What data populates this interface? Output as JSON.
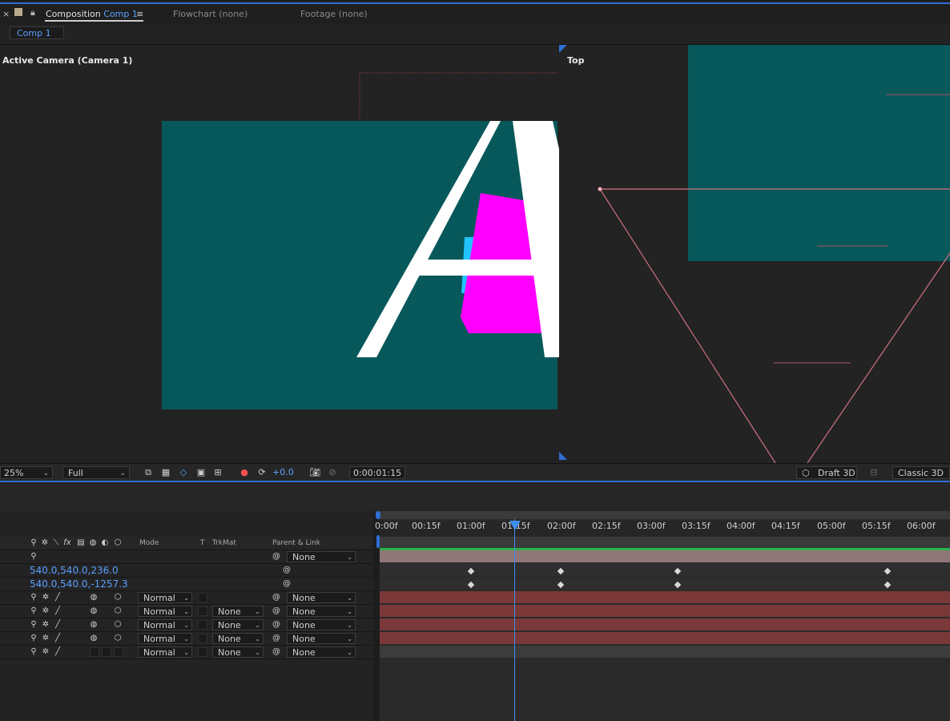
{
  "tabs": {
    "close": "×",
    "composition_label": "Composition",
    "composition_name": "Comp 1",
    "menu_icon": "≡",
    "flowchart_label": "Flowchart",
    "flowchart_value": "(none)",
    "footage_label": "Footage",
    "footage_value": "(none)"
  },
  "subbar": {
    "comp_chip": "Comp 1"
  },
  "viewer_left": {
    "label": "Active Camera (Camera 1)"
  },
  "viewer_right": {
    "label": "Top"
  },
  "viewer_toolbar": {
    "zoom": "25%",
    "resolution": "Full",
    "exposure": "+0.0",
    "timecode": "0:00:01:15",
    "renderer": "Draft 3D",
    "mode3d": "Classic 3D"
  },
  "columns": {
    "mode": "Mode",
    "t": "T",
    "trkmat": "TrkMat",
    "parent": "Parent & Link"
  },
  "rows": [
    {
      "type": "parent",
      "parent": "None"
    },
    {
      "type": "value",
      "value": "540.0,540.0,236.0"
    },
    {
      "type": "value",
      "value": "540.0,540.0,-1257.3"
    },
    {
      "type": "layer",
      "mode": "Normal",
      "trkmat": "",
      "parent": "None"
    },
    {
      "type": "layer",
      "mode": "Normal",
      "trkmat": "None",
      "parent": "None"
    },
    {
      "type": "layer",
      "mode": "Normal",
      "trkmat": "None",
      "parent": "None"
    },
    {
      "type": "layer",
      "mode": "Normal",
      "trkmat": "None",
      "parent": "None"
    },
    {
      "type": "layer",
      "mode": "Normal",
      "trkmat": "None",
      "parent": "None"
    }
  ],
  "ruler_ticks": [
    "0:00f",
    "00:15f",
    "01:00f",
    "01:15f",
    "02:00f",
    "02:15f",
    "03:00f",
    "03:15f",
    "04:00f",
    "04:15f",
    "05:00f",
    "05:15f",
    "06:00f"
  ],
  "colors": {
    "accent": "#2f6fd6",
    "teal": "#07585a",
    "layer_bar": "#7a3838",
    "camera_bar": "#8f7679",
    "magenta": "#ff00ff"
  }
}
